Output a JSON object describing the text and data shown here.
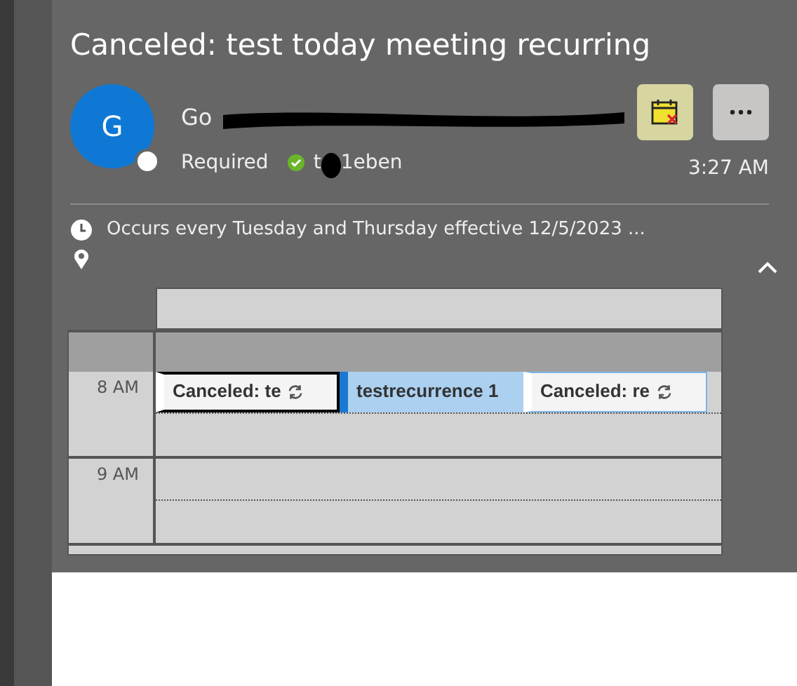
{
  "title": "Canceled: test today meeting recurring",
  "sender": {
    "avatar_letter": "G",
    "name_visible": "Go",
    "redacted": true
  },
  "attendee": {
    "role": "Required",
    "accepted": true,
    "name_start": "t",
    "name_end": "1eben"
  },
  "time": "3:27 AM",
  "recurrence": "Occurs every Tuesday and Thursday effective 12/5/2023 ...",
  "calendar": {
    "hours": [
      "8 AM",
      "9 AM"
    ],
    "events": [
      {
        "kind": "canceled",
        "title": "Canceled: te",
        "selected": true,
        "recurring": true
      },
      {
        "kind": "normal",
        "title": "testrecurrence 1",
        "selected": false,
        "recurring": false
      },
      {
        "kind": "canceled",
        "title": "Canceled: re",
        "selected": false,
        "recurring": true
      }
    ]
  }
}
